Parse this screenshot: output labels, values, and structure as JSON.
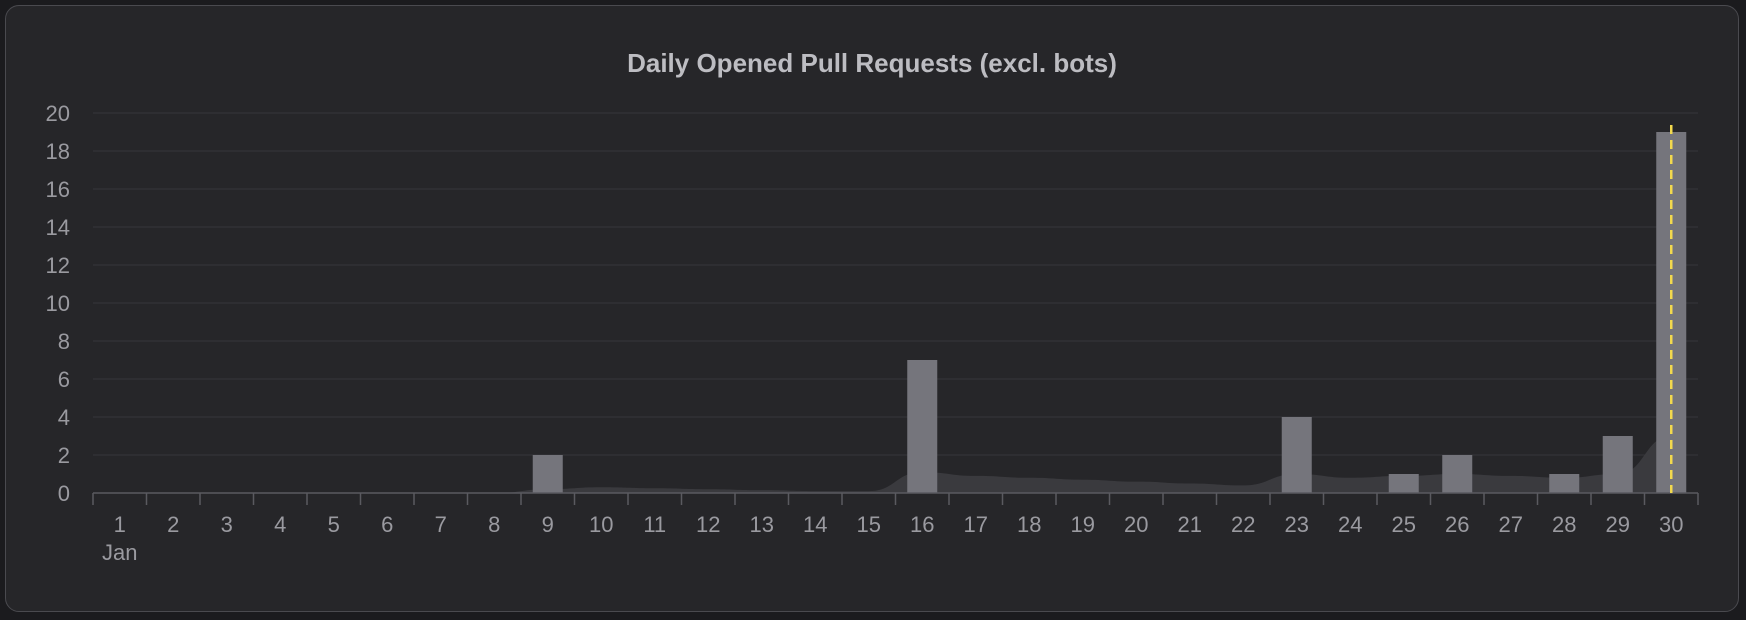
{
  "chart_data": {
    "type": "bar",
    "title": "Daily Opened Pull Requests (excl. bots)",
    "categories": [
      "1",
      "2",
      "3",
      "4",
      "5",
      "6",
      "7",
      "8",
      "9",
      "10",
      "11",
      "12",
      "13",
      "14",
      "15",
      "16",
      "17",
      "18",
      "19",
      "20",
      "21",
      "22",
      "23",
      "24",
      "25",
      "26",
      "27",
      "28",
      "29",
      "30"
    ],
    "month_label": "Jan",
    "values": [
      0,
      0,
      0,
      0,
      0,
      0,
      0,
      0,
      2,
      0,
      0,
      0,
      0,
      0,
      0,
      7,
      0,
      0,
      0,
      0,
      0,
      0,
      4,
      0,
      1,
      2,
      0,
      1,
      3,
      19
    ],
    "smoothed_area": [
      0,
      0,
      0,
      0,
      0,
      0,
      0,
      0,
      0.2,
      0.3,
      0.25,
      0.2,
      0.15,
      0.1,
      0.1,
      1.1,
      0.9,
      0.8,
      0.7,
      0.6,
      0.5,
      0.4,
      1.0,
      0.8,
      0.9,
      1.0,
      0.9,
      0.8,
      1.0,
      3.0
    ],
    "yticks": [
      0,
      2,
      4,
      6,
      8,
      10,
      12,
      14,
      16,
      18,
      20
    ],
    "ylim": [
      0,
      20
    ],
    "xlabel": "",
    "ylabel": "",
    "grid": true,
    "legend": "none",
    "highlight_category": "30",
    "colors": {
      "bar": "#75757c",
      "area": "#3a3a3e",
      "grid": "#36363a",
      "axis": "#5a5a60",
      "marker": "#f2d94e"
    }
  }
}
